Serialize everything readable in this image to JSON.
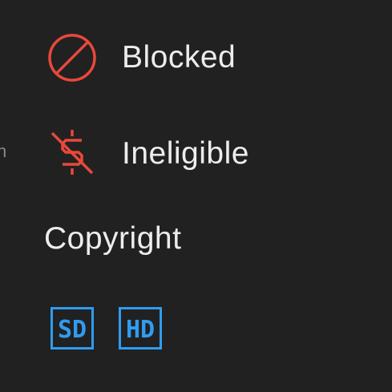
{
  "colors": {
    "background": "#212121",
    "text": "#ededed",
    "status_red": "#e8483c",
    "badge_blue": "#2f9cf0"
  },
  "statuses": [
    {
      "label": "Blocked",
      "icon": "blocked-circle-slash-icon"
    },
    {
      "label": "Ineligible",
      "icon": "dollar-crossed-icon"
    }
  ],
  "copyright": {
    "title": "Copyright",
    "badges": [
      "SD",
      "HD"
    ]
  }
}
